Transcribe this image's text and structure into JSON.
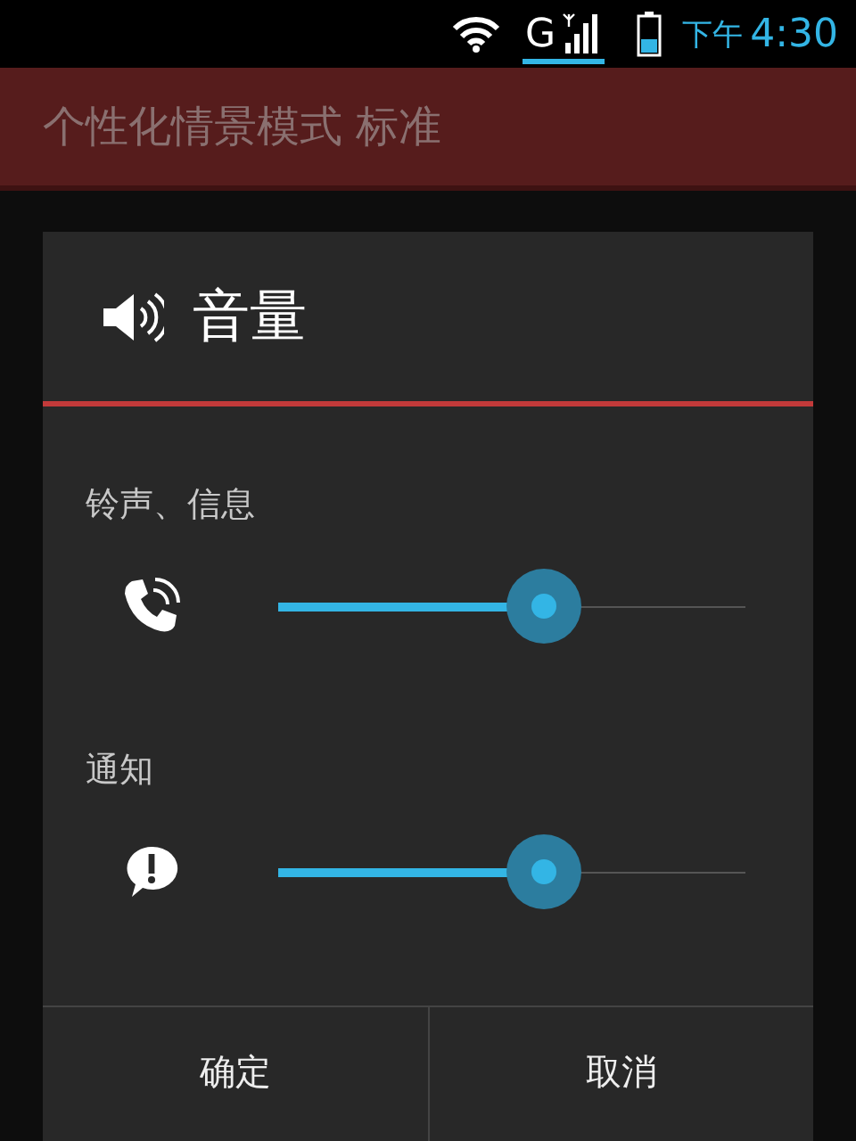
{
  "status_bar": {
    "network": "G",
    "time_period": "下午",
    "time": "4:30"
  },
  "action_bar": {
    "title": "个性化情景模式 标准"
  },
  "dialog": {
    "title": "音量",
    "sections": [
      {
        "label": "铃声、信息",
        "kind": "ringer",
        "level": 0.57
      },
      {
        "label": "通知",
        "kind": "notification",
        "level": 0.57
      }
    ],
    "buttons": [
      "确定",
      "取消"
    ]
  }
}
